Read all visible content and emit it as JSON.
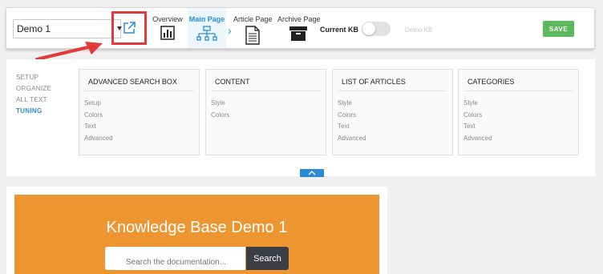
{
  "toolbar": {
    "kb_select": {
      "value": "Demo 1"
    },
    "nav": [
      {
        "label": "Overview",
        "icon": "bar-chart-icon"
      },
      {
        "label": "Main Page",
        "icon": "sitemap-icon"
      },
      {
        "label": "Article Page",
        "icon": "document-icon"
      },
      {
        "label": "Archive Page",
        "icon": "archive-icon"
      }
    ],
    "current_kb_label": "Current KB",
    "demo_kb_label": "Demo KB",
    "save_label": "SAVE"
  },
  "side_nav": [
    "SETUP",
    "ORGANIZE",
    "ALL TEXT",
    "TUNING"
  ],
  "boxes": [
    {
      "title": "ADVANCED SEARCH BOX",
      "options": [
        "Setup",
        "Colors",
        "Text",
        "Advanced"
      ]
    },
    {
      "title": "CONTENT",
      "options": [
        "Style",
        "Colors"
      ]
    },
    {
      "title": "LIST OF ARTICLES",
      "options": [
        "Style",
        "Colors",
        "Text",
        "Advanced"
      ]
    },
    {
      "title": "CATEGORIES",
      "options": [
        "Style",
        "Colors",
        "Text",
        "Advanced"
      ]
    }
  ],
  "preview": {
    "title": "Knowledge Base Demo 1",
    "search_placeholder": "Search the documentation...",
    "search_button": "Search"
  },
  "colors": {
    "accent": "#2a8cd6",
    "save": "#5cb85c",
    "banner": "#ed9531",
    "highlight": "#e03a3a"
  }
}
